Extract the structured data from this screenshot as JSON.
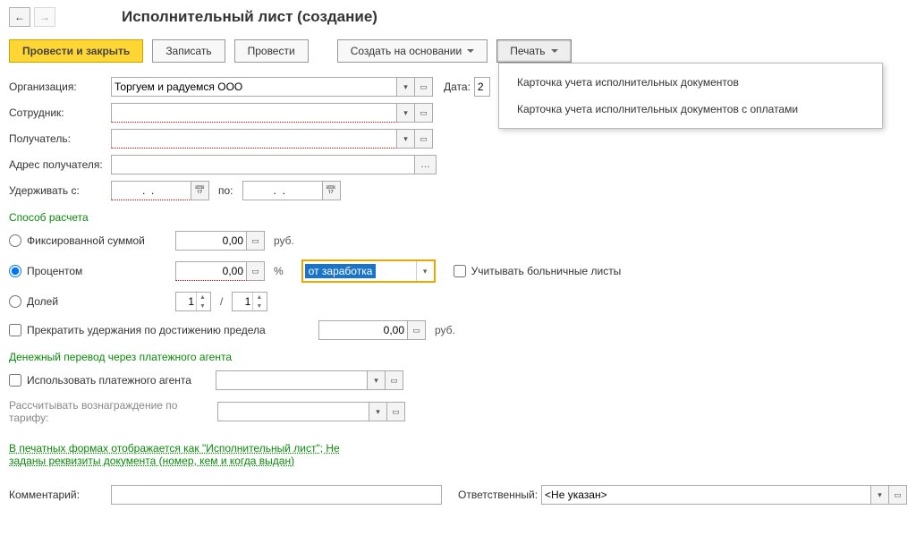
{
  "title": "Исполнительный лист (создание)",
  "toolbar": {
    "primary": "Провести и закрыть",
    "save": "Записать",
    "post": "Провести",
    "createBased": "Создать на основании",
    "print": "Печать"
  },
  "printMenu": {
    "item1": "Карточка учета исполнительных документов",
    "item2": "Карточка учета исполнительных документов с оплатами"
  },
  "labels": {
    "org": "Организация:",
    "emp": "Сотрудник:",
    "recipient": "Получатель:",
    "recipientAddr": "Адрес получателя:",
    "dateLabel": "Дата:",
    "withholdFrom": "Удерживать с:",
    "to": "по:",
    "calcMethod": "Способ расчета",
    "fixedAmount": "Фиксированной суммой",
    "percent": "Процентом",
    "fraction": "Долей",
    "rub": "руб.",
    "pct": "%",
    "slash": "/",
    "percentBase": "от заработка",
    "considerSick": "Учитывать больничные листы",
    "stopOnLimit": "Прекратить удержания по достижению предела",
    "moneyTransfer": "Денежный перевод через платежного агента",
    "useAgent": "Использовать платежного агента",
    "tariff": "Рассчитывать вознаграждение по тарифу:",
    "link": "В печатных формах отображается как \"Исполнительный лист\"; Не заданы реквизиты документа (номер, кем и когда выдан)",
    "comment": "Комментарий:",
    "responsible": "Ответственный:"
  },
  "values": {
    "org": "Торгуем и радуемся ООО",
    "date": "2",
    "dateEmpty": "  .  .    ",
    "zero2": "0,00",
    "one": "1",
    "responsible": "<Не указан>"
  }
}
